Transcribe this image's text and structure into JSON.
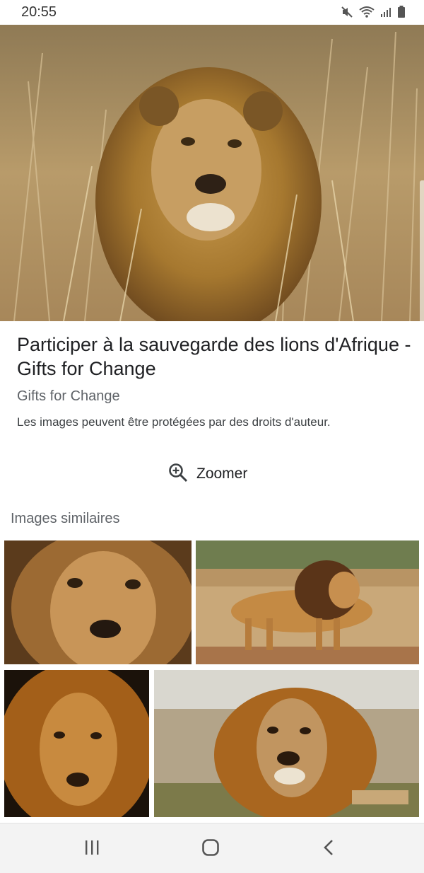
{
  "status_bar": {
    "time": "20:55"
  },
  "result": {
    "title": "Participer à la sauvegarde des lions d'Afrique - Gifts for Change",
    "source": "Gifts for Change",
    "copyright": "Les images peuvent être protégées par des droits d'auteur."
  },
  "actions": {
    "zoom_label": "Zoomer"
  },
  "similar": {
    "heading": "Images similaires"
  },
  "colors": {
    "accent": "#202124",
    "muted": "#5f6368",
    "nav_bg": "#f3f3f3"
  }
}
